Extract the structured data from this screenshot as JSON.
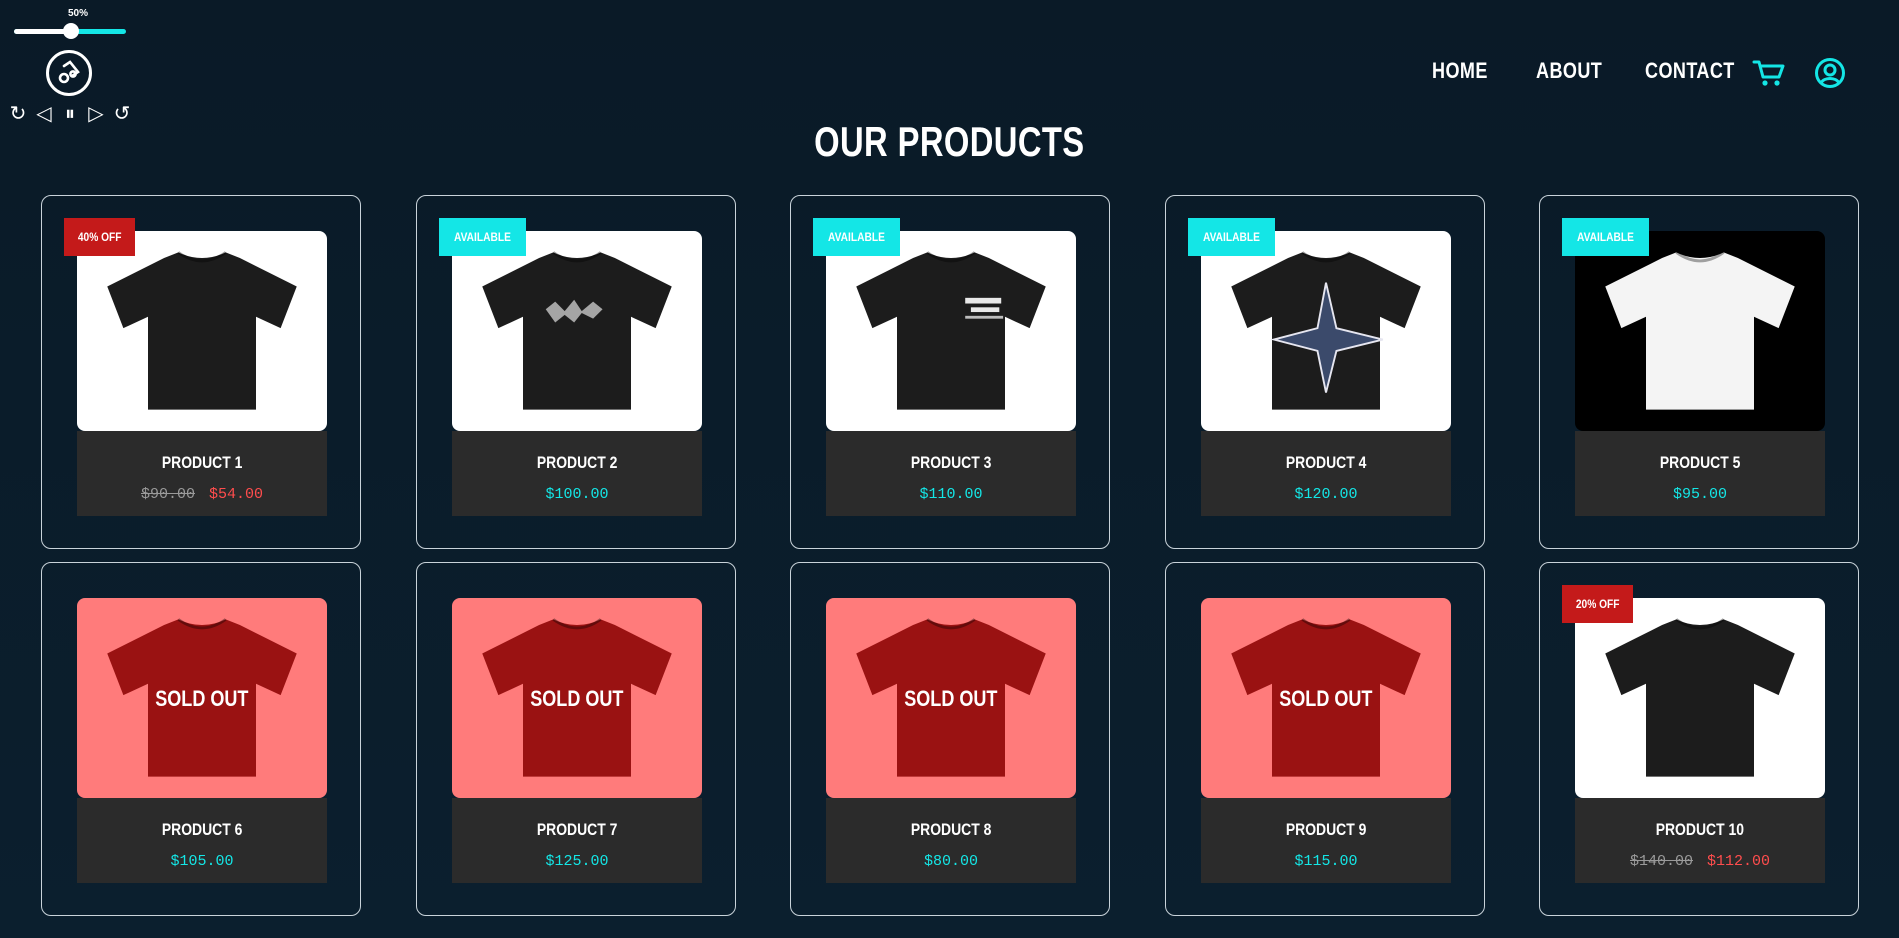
{
  "player": {
    "volume_label": "50%",
    "volume": 0.5,
    "controls": [
      "↻",
      "◁",
      "⏸",
      "▷",
      "↺"
    ],
    "control_names": [
      "restart-icon",
      "previous-icon",
      "pause-icon",
      "play-icon",
      "replay-icon"
    ]
  },
  "nav": {
    "links": [
      "HOME",
      "ABOUT",
      "CONTACT"
    ],
    "cart_icon": "cart-icon",
    "account_icon": "user-icon",
    "accent": "#14e6e6"
  },
  "page": {
    "title": "OUR PRODUCTS"
  },
  "colors": {
    "accent": "#14e6e6",
    "sale": "#ff4d4d",
    "badge_off": "#c41a1a",
    "sold_bg": "#ff7b7b",
    "shirt_sold": "#9a1212"
  },
  "products": [
    {
      "name": "PRODUCT 1",
      "badge": "40% OFF",
      "badge_type": "off",
      "old_price": "$90.00",
      "price": "$54.00",
      "style": "plain-black",
      "bg": "white"
    },
    {
      "name": "PRODUCT 2",
      "badge": "AVAILABLE",
      "badge_type": "avail",
      "price": "$100.00",
      "style": "graphic-logo",
      "bg": "white"
    },
    {
      "name": "PRODUCT 3",
      "badge": "AVAILABLE",
      "badge_type": "avail",
      "price": "$110.00",
      "style": "chest-print",
      "bg": "white"
    },
    {
      "name": "PRODUCT 4",
      "badge": "AVAILABLE",
      "badge_type": "avail",
      "price": "$120.00",
      "style": "star-print",
      "bg": "white"
    },
    {
      "name": "PRODUCT 5",
      "badge": "AVAILABLE",
      "badge_type": "avail",
      "price": "$95.00",
      "style": "plain-white",
      "bg": "black"
    },
    {
      "name": "PRODUCT 6",
      "sold": "SOLD OUT",
      "price": "$105.00",
      "style": "sold",
      "bg": "sold"
    },
    {
      "name": "PRODUCT 7",
      "sold": "SOLD OUT",
      "price": "$125.00",
      "style": "sold",
      "bg": "sold"
    },
    {
      "name": "PRODUCT 8",
      "sold": "SOLD OUT",
      "price": "$80.00",
      "style": "sold",
      "bg": "sold"
    },
    {
      "name": "PRODUCT 9",
      "sold": "SOLD OUT",
      "price": "$115.00",
      "style": "sold",
      "bg": "sold"
    },
    {
      "name": "PRODUCT 10",
      "badge": "20% OFF",
      "badge_type": "off",
      "old_price": "$140.00",
      "price": "$112.00",
      "style": "plain-black",
      "bg": "white"
    }
  ]
}
